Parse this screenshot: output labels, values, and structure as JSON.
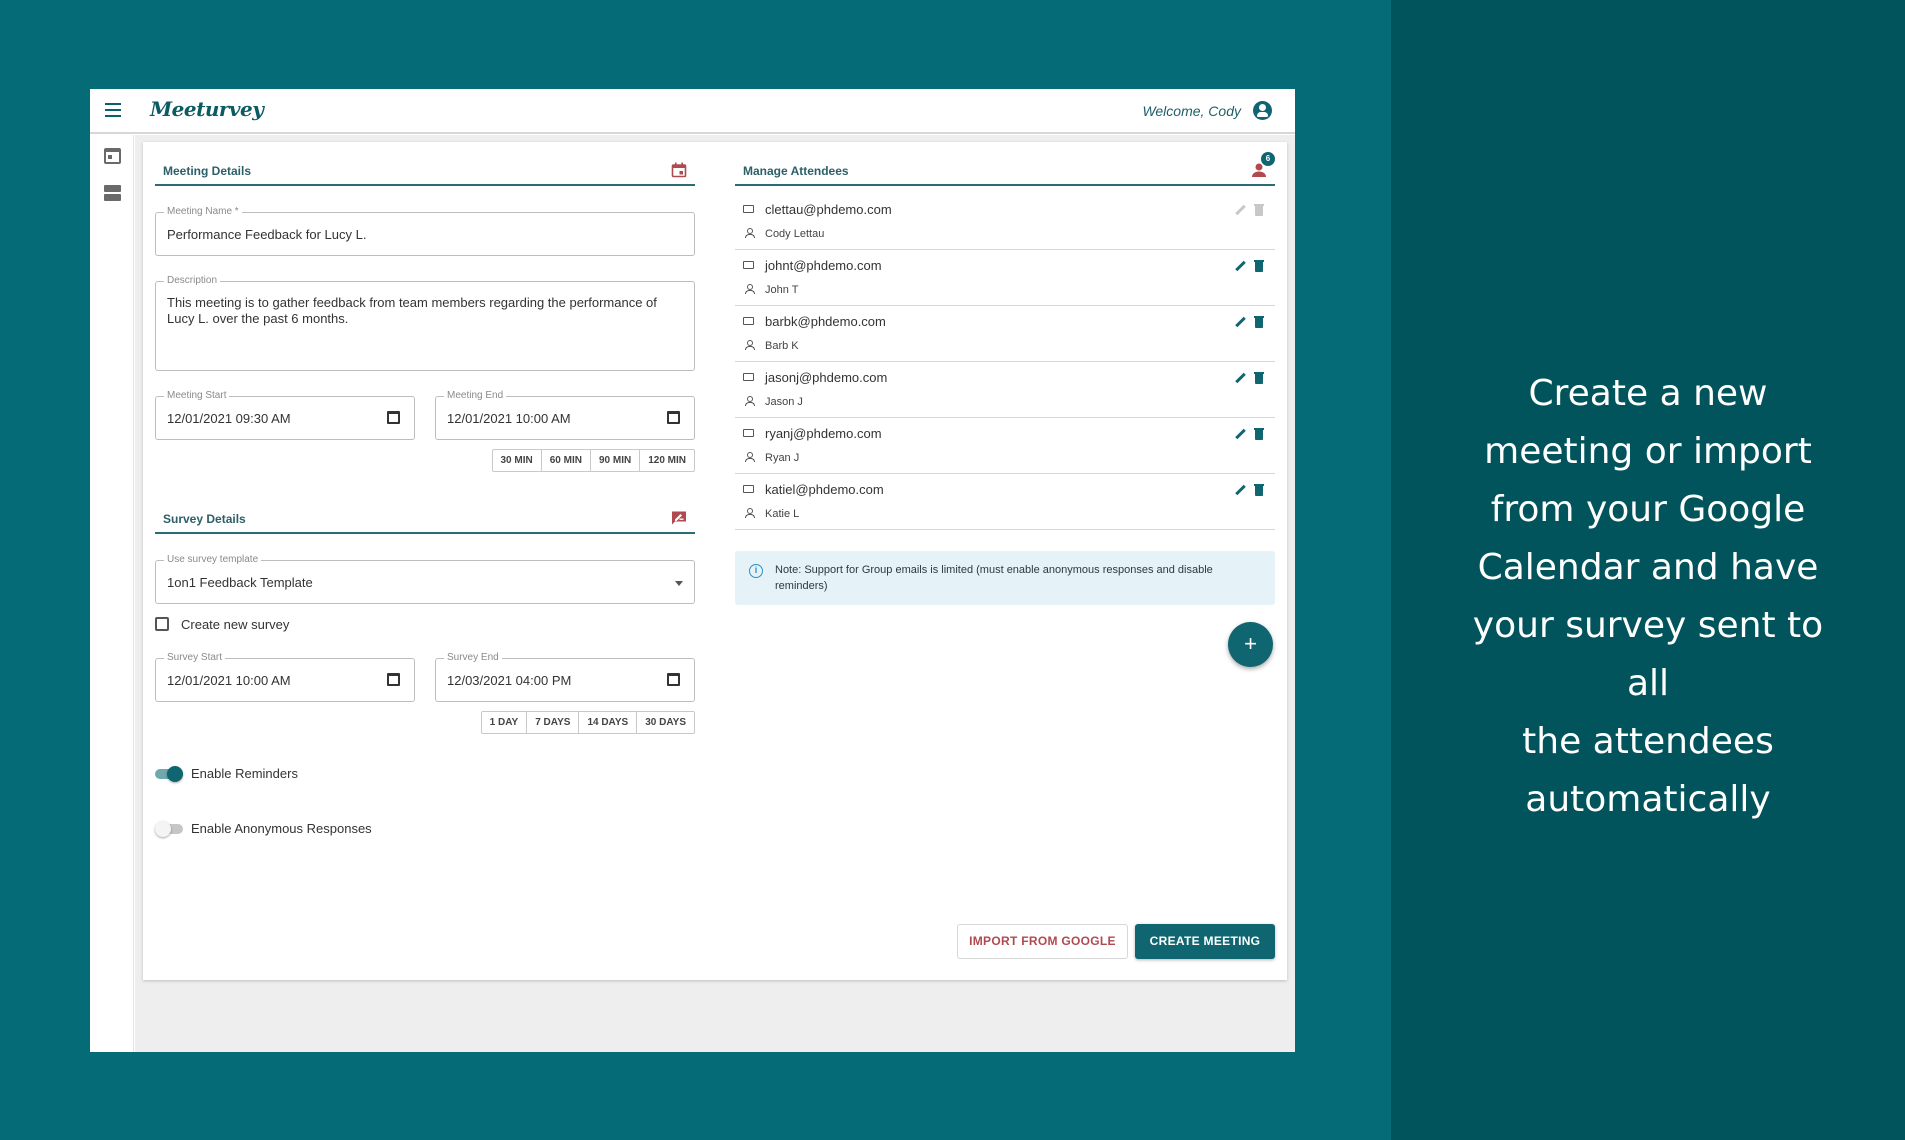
{
  "promo": {
    "lines": [
      "Create a new",
      "meeting or import",
      "from your Google",
      "Calendar and have",
      "your survey sent to all",
      "the attendees",
      "automatically"
    ]
  },
  "header": {
    "logo": "Meeturvey",
    "welcome": "Welcome, Cody"
  },
  "meeting": {
    "section_title": "Meeting Details",
    "name_label": "Meeting Name *",
    "name_value": "Performance Feedback for Lucy L.",
    "description_label": "Description",
    "description_value": "This meeting is to gather feedback from team members regarding the performance of Lucy L. over the past 6 months.",
    "start_label": "Meeting Start",
    "start_value": "12/01/2021 09:30 AM",
    "end_label": "Meeting End",
    "end_value": "12/01/2021 10:00 AM",
    "durations": [
      "30 MIN",
      "60 MIN",
      "90 MIN",
      "120 MIN"
    ]
  },
  "survey": {
    "section_title": "Survey Details",
    "template_label": "Use survey template",
    "template_value": "1on1 Feedback Template",
    "create_new_label": "Create new survey",
    "start_label": "Survey Start",
    "start_value": "12/01/2021 10:00 AM",
    "end_label": "Survey End",
    "end_value": "12/03/2021 04:00 PM",
    "durations": [
      "1 DAY",
      "7 DAYS",
      "14 DAYS",
      "30 DAYS"
    ],
    "reminders_label": "Enable Reminders",
    "reminders_enabled": true,
    "anonymous_label": "Enable Anonymous Responses",
    "anonymous_enabled": false
  },
  "attendees": {
    "section_title": "Manage Attendees",
    "count": "6",
    "items": [
      {
        "email": "clettau@phdemo.com",
        "name": "Cody Lettau"
      },
      {
        "email": "johnt@phdemo.com",
        "name": "John T"
      },
      {
        "email": "barbk@phdemo.com",
        "name": "Barb K"
      },
      {
        "email": "jasonj@phdemo.com",
        "name": "Jason J"
      },
      {
        "email": "ryanj@phdemo.com",
        "name": "Ryan J"
      },
      {
        "email": "katiel@phdemo.com",
        "name": "Katie L"
      }
    ],
    "note": "Note: Support for Group emails is limited (must enable anonymous responses and disable reminders)",
    "add_label": "+"
  },
  "actions": {
    "import_label": "IMPORT FROM GOOGLE",
    "create_label": "CREATE MEETING"
  },
  "colors": {
    "background": "#056b76",
    "panel": "#02545c",
    "primary": "#0f6670",
    "accent_red": "#b04a50"
  }
}
